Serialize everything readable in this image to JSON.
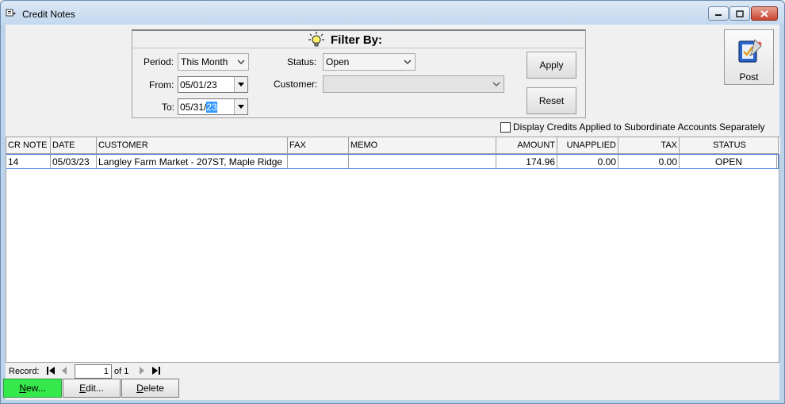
{
  "window": {
    "title": "Credit Notes"
  },
  "filter": {
    "title": "Filter By:",
    "period_label": "Period:",
    "period_value": "This Month",
    "from_label": "From:",
    "from_value_prefix": "05/01/23",
    "to_label": "To:",
    "to_value_prefix": "05/31/",
    "to_value_selected": "23",
    "status_label": "Status:",
    "status_value": "Open",
    "customer_label": "Customer:",
    "customer_value": "",
    "apply_label": "Apply",
    "reset_label": "Reset"
  },
  "post": {
    "label": "Post"
  },
  "options": {
    "subordinate_label": "Display Credits Applied to Subordinate Accounts Separately"
  },
  "grid": {
    "columns": [
      "CR NOTE",
      "DATE",
      "CUSTOMER",
      "FAX",
      "MEMO",
      "AMOUNT",
      "UNAPPLIED",
      "TAX",
      "STATUS"
    ],
    "rows": [
      {
        "cr_note": "14",
        "date": "05/03/23",
        "customer": "Langley Farm Market - 207ST, Maple Ridge",
        "fax": "",
        "memo": "",
        "amount": "174.96",
        "unapplied": "0.00",
        "tax": "0.00",
        "status": "OPEN"
      }
    ]
  },
  "navigator": {
    "record_label": "Record:",
    "current": "1",
    "of_label": "of 1"
  },
  "actions": {
    "new_prefix": "N",
    "new_rest": "ew...",
    "edit_prefix": "E",
    "edit_rest": "dit...",
    "delete_prefix": "D",
    "delete_rest": "elete"
  },
  "colors": {
    "title_bar": "#c3d8ef",
    "new_button": "#35e84b",
    "selection": "#3399ff",
    "close_button": "#c8452f"
  }
}
